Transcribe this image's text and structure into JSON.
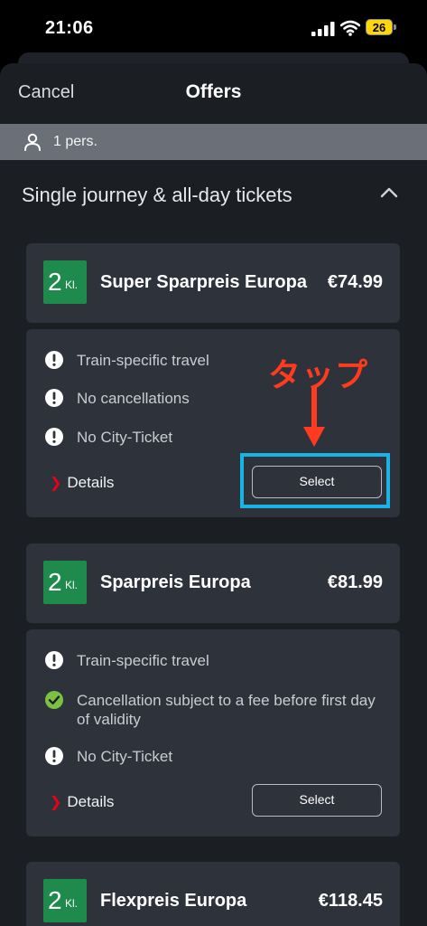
{
  "status_bar": {
    "time": "21:06",
    "battery": "26"
  },
  "nav": {
    "cancel": "Cancel",
    "title": "Offers"
  },
  "passengers": {
    "label": "1 pers."
  },
  "section": {
    "title": "Single journey & all-day tickets"
  },
  "offers": [
    {
      "class_num": "2",
      "class_suffix": "Kl.",
      "name": "Super Sparpreis Europa",
      "price": "€74.99",
      "features": [
        {
          "icon": "exclamation-circle-icon",
          "text": "Train-specific travel"
        },
        {
          "icon": "exclamation-circle-icon",
          "text": "No cancellations"
        },
        {
          "icon": "exclamation-circle-icon",
          "text": "No City-Ticket"
        }
      ],
      "details": "Details",
      "select": "Select"
    },
    {
      "class_num": "2",
      "class_suffix": "Kl.",
      "name": "Sparpreis Europa",
      "price": "€81.99",
      "features": [
        {
          "icon": "exclamation-circle-icon",
          "text": "Train-specific travel"
        },
        {
          "icon": "check-circle-icon",
          "text": "Cancellation subject to a fee before first day of validity"
        },
        {
          "icon": "exclamation-circle-icon",
          "text": "No City-Ticket"
        }
      ],
      "details": "Details",
      "select": "Select"
    },
    {
      "class_num": "2",
      "class_suffix": "Kl.",
      "name": "Flexpreis Europa",
      "price": "€118.45"
    }
  ],
  "annotation": {
    "text": "タップ"
  },
  "colors": {
    "accent_red": "#ec0016",
    "class_green": "#1e8a4c",
    "check_green": "#7cc242",
    "annotation_red": "#ff3b1f",
    "highlight_blue": "#18b4e6"
  }
}
